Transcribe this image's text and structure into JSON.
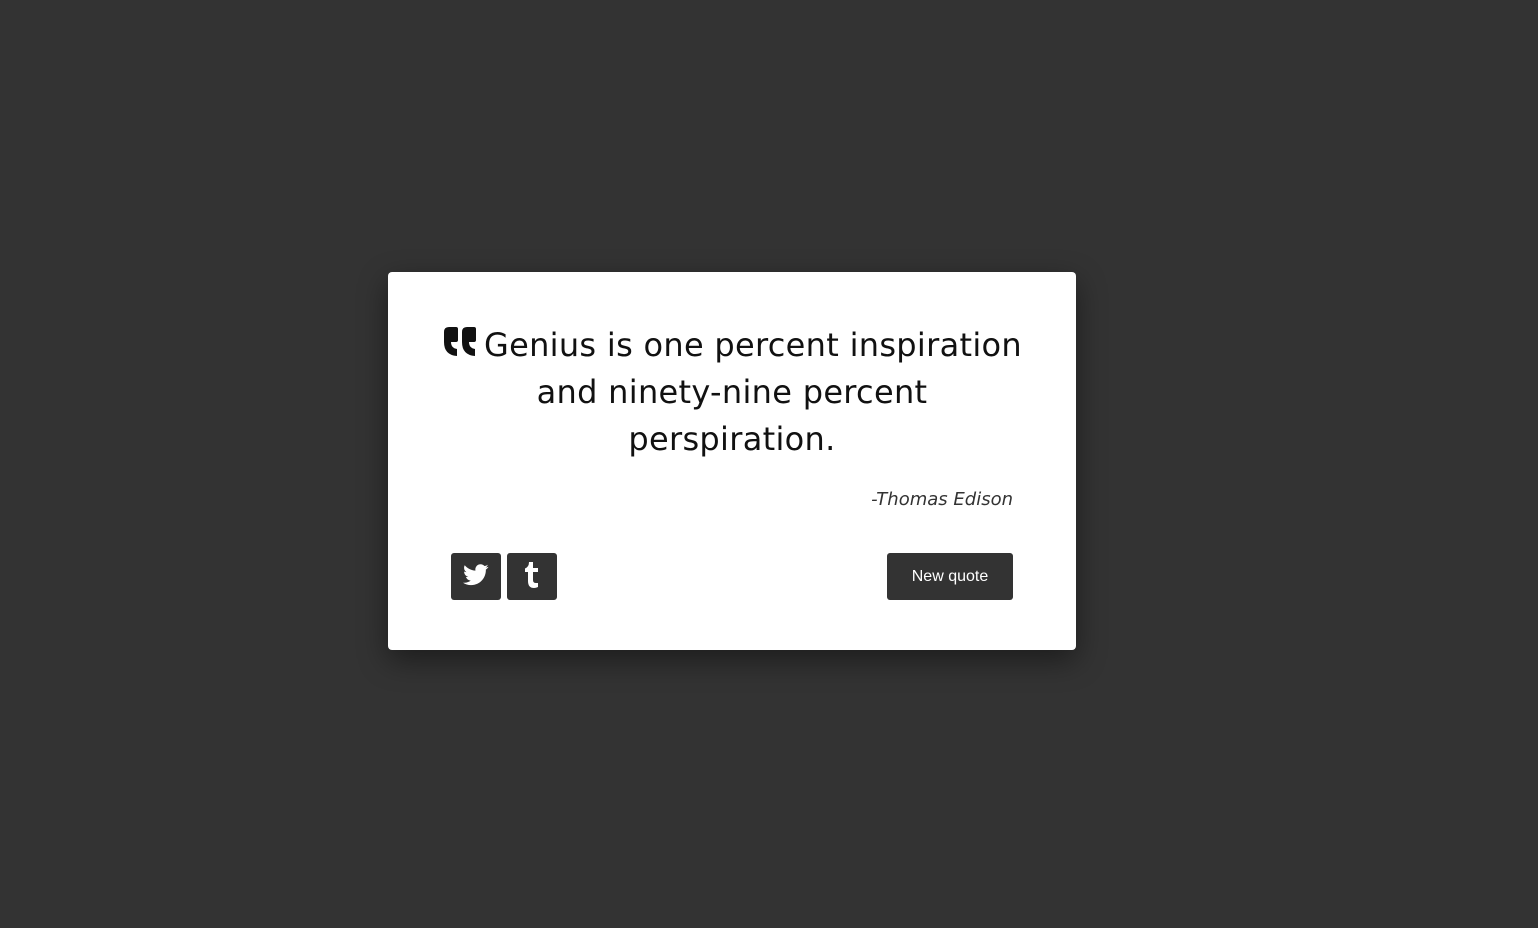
{
  "quote": {
    "text": "Genius is one percent inspiration and ninety-nine percent perspiration.",
    "author": "-Thomas Edison",
    "icon": "quote-left-icon"
  },
  "actions": {
    "twitter_icon": "twitter-icon",
    "tumblr_icon": "tumblr-icon",
    "new_quote_label": "New quote"
  },
  "colors": {
    "background": "#333333",
    "card": "#ffffff",
    "button": "#333333",
    "button_text": "#ffffff"
  }
}
